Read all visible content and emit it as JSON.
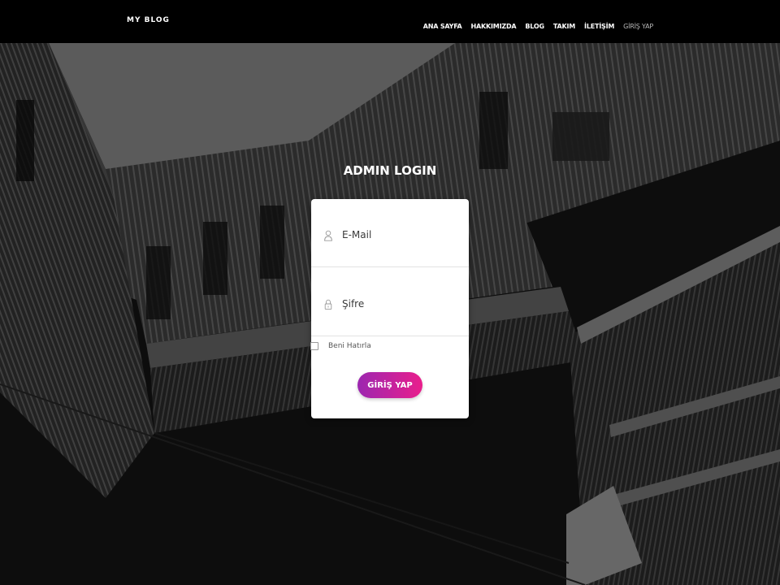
{
  "navbar": {
    "brand": "MY BLOG",
    "links": [
      {
        "label": "ANA SAYFA"
      },
      {
        "label": "HAKKIMIZDA"
      },
      {
        "label": "BLOG"
      },
      {
        "label": "TAKIM"
      },
      {
        "label": "İLETİŞİM"
      },
      {
        "label": "GİRİŞ YAP"
      }
    ]
  },
  "login": {
    "title": "ADMIN LOGIN",
    "email": {
      "placeholder": "E-Mail",
      "value": "",
      "icon": "user-icon"
    },
    "password": {
      "placeholder": "Şifre",
      "value": "",
      "icon": "lock-icon"
    },
    "remember_label": "Beni Hatırla",
    "remember_checked": false,
    "submit_label": "GİRİŞ YAP"
  },
  "colors": {
    "button_gradient_start": "#9c27b0",
    "button_gradient_end": "#e91e8c",
    "navbar_bg": "#000000"
  }
}
